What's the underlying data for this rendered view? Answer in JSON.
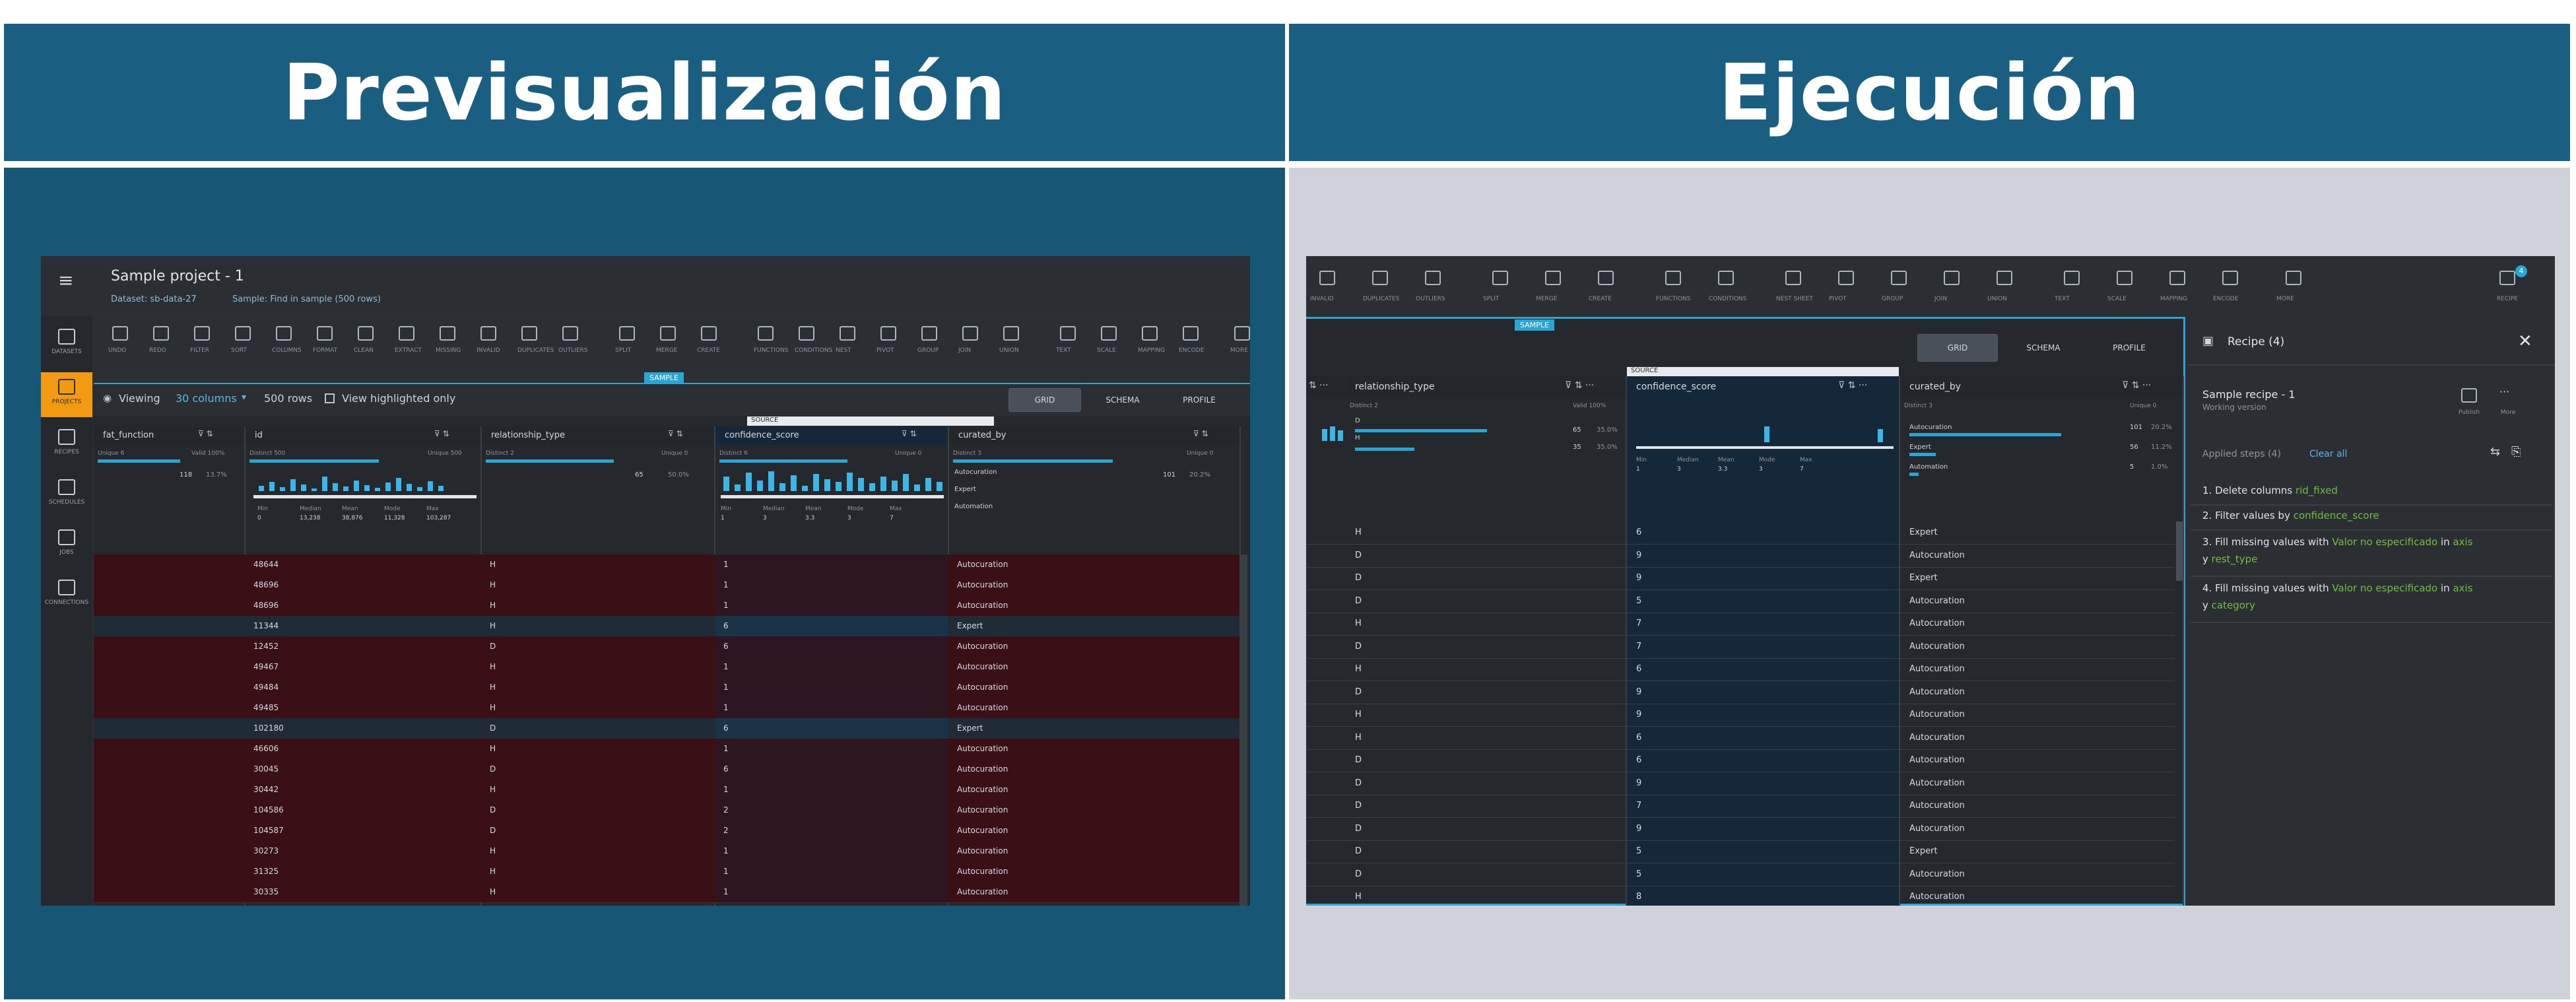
{
  "headers": {
    "left": "Previsualización",
    "right": "Ejecución"
  },
  "preview": {
    "project_title": "Sample project - 1",
    "dataset_info": "Dataset: sb-data-27",
    "recipe_info": "Sample: Find in sample (500 rows)",
    "sidebar": [
      {
        "label": "DATASETS",
        "icon": "database-icon"
      },
      {
        "label": "PROJECTS",
        "icon": "grid-icon"
      },
      {
        "label": "RECIPES",
        "icon": "list-icon"
      },
      {
        "label": "SCHEDULES",
        "icon": "calendar-icon"
      },
      {
        "label": "JOBS",
        "icon": "play-icon"
      },
      {
        "label": "CONNECTIONS",
        "icon": "plug-icon"
      }
    ],
    "toolbar": [
      "UNDO",
      "REDO",
      "FILTER",
      "SORT",
      "COLUMNS",
      "FORMAT",
      "CLEAN",
      "EXTRACT",
      "MISSING",
      "INVALID",
      "DUPLICATES",
      "OUTLIERS",
      "SPLIT",
      "MERGE",
      "CREATE",
      "FUNCTIONS",
      "CONDITIONS",
      "NEST",
      "PIVOT",
      "GROUP",
      "JOIN",
      "UNION",
      "TEXT",
      "SCALE",
      "MAPPING",
      "ENCODE",
      "MORE"
    ],
    "viewing_label": "Viewing",
    "columns_selector": "30 columns",
    "rows_label": "500 rows",
    "highlight_label": "View highlighted only",
    "sample_tag": "SAMPLE",
    "source_tag": "SOURCE",
    "view_tabs": [
      "GRID",
      "SCHEMA",
      "PROFILE"
    ],
    "column_headers": [
      "fat_function",
      "id",
      "relationship_type",
      "confidence_score",
      "curated_by"
    ],
    "column_stats": [
      {
        "dist": "Unique 6",
        "valid": "Valid 100%"
      },
      {
        "dist": "Distinct 500",
        "valid": "Unique 500"
      },
      {
        "dist": "Distinct 2",
        "valid": "Unique 0"
      },
      {
        "dist": "Distinct 6",
        "valid": "Unique 0"
      },
      {
        "dist": "Distinct 3",
        "valid": "Unique 0"
      }
    ],
    "stat_values": [
      "118",
      "13.7%",
      "65",
      "50.0%",
      "101",
      "20.2%"
    ],
    "summary_labels": [
      "Min",
      "Median",
      "Mean",
      "Mode",
      "Max"
    ],
    "id_summary": [
      "0",
      "13,238",
      "38,876",
      "11,328",
      "103,287"
    ],
    "score_summary": [
      "1",
      "3",
      "3.3",
      "3",
      "7"
    ],
    "curated_values": [
      "Autocuration",
      "Expert",
      "Automation"
    ],
    "rows": [
      {
        "id": "48644",
        "rel": "H",
        "score": "1",
        "curator": "Autocuration"
      },
      {
        "id": "48696",
        "rel": "H",
        "score": "1",
        "curator": "Autocuration"
      },
      {
        "id": "48696",
        "rel": "H",
        "score": "1",
        "curator": "Autocuration"
      },
      {
        "id": "11344",
        "rel": "H",
        "score": "6",
        "curator": "Expert"
      },
      {
        "id": "12452",
        "rel": "D",
        "score": "6",
        "curator": "Autocuration"
      },
      {
        "id": "49467",
        "rel": "H",
        "score": "1",
        "curator": "Autocuration"
      },
      {
        "id": "49484",
        "rel": "H",
        "score": "1",
        "curator": "Autocuration"
      },
      {
        "id": "49485",
        "rel": "H",
        "score": "1",
        "curator": "Autocuration"
      },
      {
        "id": "102180",
        "rel": "D",
        "score": "6",
        "curator": "Expert"
      },
      {
        "id": "46606",
        "rel": "H",
        "score": "1",
        "curator": "Autocuration"
      },
      {
        "id": "30045",
        "rel": "D",
        "score": "6",
        "curator": "Autocuration"
      },
      {
        "id": "30442",
        "rel": "H",
        "score": "1",
        "curator": "Autocuration"
      },
      {
        "id": "104586",
        "rel": "D",
        "score": "2",
        "curator": "Autocuration"
      },
      {
        "id": "104587",
        "rel": "D",
        "score": "2",
        "curator": "Autocuration"
      },
      {
        "id": "30273",
        "rel": "H",
        "score": "1",
        "curator": "Autocuration"
      },
      {
        "id": "31325",
        "rel": "H",
        "score": "1",
        "curator": "Autocuration"
      },
      {
        "id": "30335",
        "rel": "H",
        "score": "1",
        "curator": "Autocuration"
      }
    ]
  },
  "execution": {
    "toolbar": [
      "INVALID",
      "DUPLICATES",
      "OUTLIERS",
      "SPLIT",
      "MERGE",
      "CREATE",
      "FUNCTIONS",
      "CONDITIONS",
      "NEST SHEET",
      "PIVOT",
      "GROUP",
      "JOIN",
      "UNION",
      "TEXT",
      "SCALE",
      "MAPPING",
      "ENCODE",
      "MORE"
    ],
    "recipe_button": "RECIPE",
    "recipe_badge": "4",
    "sample_tag": "SAMPLE",
    "source_tag": "SOURCE",
    "view_tabs": [
      "GRID",
      "SCHEMA",
      "PROFILE"
    ],
    "column_headers": [
      "relationship_type",
      "confidence_score",
      "curated_by"
    ],
    "column_stats": [
      {
        "dist": "Distinct 2",
        "valid": "Valid 100%"
      },
      {
        "dist": "Distinct 6",
        "valid": "Unique 0"
      },
      {
        "dist": "Distinct 3",
        "valid": "Unique 0"
      }
    ],
    "rel_stats": [
      "65",
      "35.0%",
      "35",
      "35.0%"
    ],
    "curated_stats": [
      "101",
      "20.2%",
      "56",
      "11.2%",
      "5",
      "1.0%"
    ],
    "curated_values": [
      "Autocuration",
      "Expert",
      "Automation"
    ],
    "score_summary": [
      "1",
      "3",
      "3.3",
      "3",
      "7"
    ],
    "summary_labels": [
      "Min",
      "Median",
      "Mean",
      "Mode",
      "Max"
    ],
    "rows": [
      {
        "rel": "H",
        "score": "6",
        "curator": "Expert"
      },
      {
        "rel": "D",
        "score": "9",
        "curator": "Autocuration"
      },
      {
        "rel": "D",
        "score": "9",
        "curator": "Expert"
      },
      {
        "rel": "D",
        "score": "5",
        "curator": "Autocuration"
      },
      {
        "rel": "H",
        "score": "7",
        "curator": "Autocuration"
      },
      {
        "rel": "D",
        "score": "7",
        "curator": "Autocuration"
      },
      {
        "rel": "H",
        "score": "6",
        "curator": "Autocuration"
      },
      {
        "rel": "D",
        "score": "9",
        "curator": "Autocuration"
      },
      {
        "rel": "H",
        "score": "9",
        "curator": "Autocuration"
      },
      {
        "rel": "H",
        "score": "6",
        "curator": "Autocuration"
      },
      {
        "rel": "D",
        "score": "6",
        "curator": "Autocuration"
      },
      {
        "rel": "D",
        "score": "9",
        "curator": "Autocuration"
      },
      {
        "rel": "D",
        "score": "7",
        "curator": "Autocuration"
      },
      {
        "rel": "D",
        "score": "9",
        "curator": "Autocuration"
      },
      {
        "rel": "D",
        "score": "5",
        "curator": "Expert"
      },
      {
        "rel": "D",
        "score": "5",
        "curator": "Autocuration"
      },
      {
        "rel": "H",
        "score": "8",
        "curator": "Autocuration"
      }
    ],
    "recipe_panel": {
      "title": "Recipe (4)",
      "recipe_name": "Sample recipe - 1",
      "recipe_sub": "Working version",
      "publish": "Publish",
      "more": "More",
      "applied_steps": "Applied steps (4)",
      "clear_all": "Clear all",
      "steps": [
        {
          "text": "1. Delete columns ",
          "highlight": "rid_fixed",
          "tail": ""
        },
        {
          "text": "2. Filter values by ",
          "highlight": "confidence_score",
          "tail": ""
        },
        {
          "text": "3. Fill missing values with ",
          "highlight": "Valor no especificado",
          "tail": " in ",
          "h2": "axis",
          "line2": "y ",
          "h3": "rest_type"
        },
        {
          "text": "4. Fill missing values with ",
          "highlight": "Valor no especificado",
          "tail": " in ",
          "h2": "axis",
          "line2": "y ",
          "h3": "category"
        }
      ]
    }
  },
  "colors": {
    "banner": "#1a5f82",
    "left_bg": "#175675",
    "right_bg": "#cfd2d8",
    "accent": "#2aa6d4",
    "row_red": "#3a0f16",
    "row_blue": "#15283a"
  }
}
